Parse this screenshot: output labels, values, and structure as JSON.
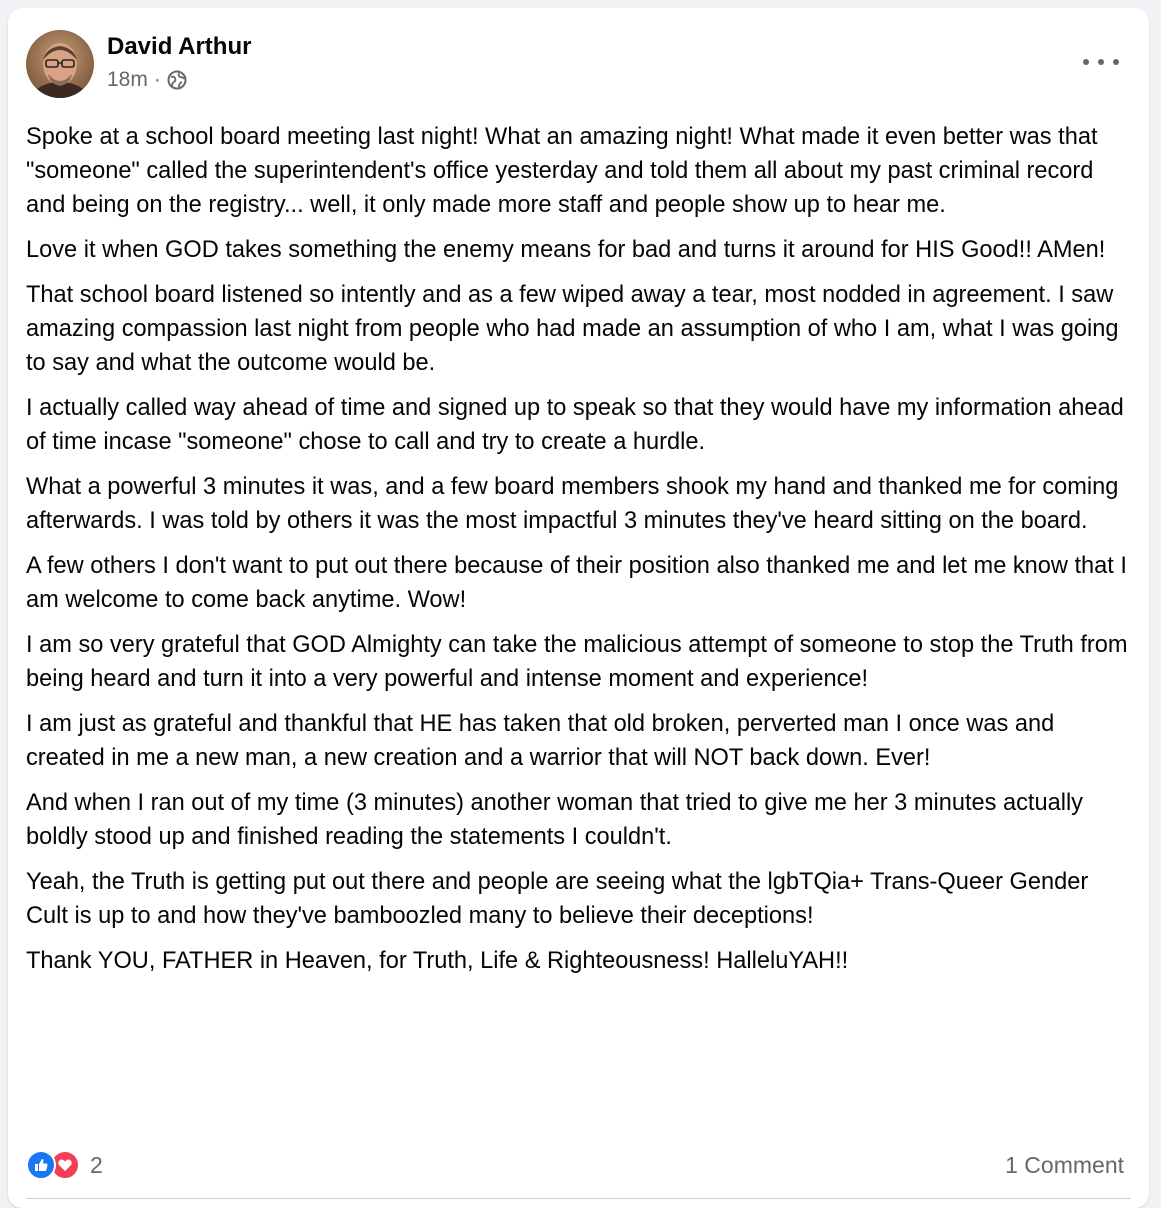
{
  "post": {
    "author": "David Arthur",
    "time": "18m",
    "separator": "·",
    "privacy_icon": "globe-icon",
    "more_icon": "more-options-icon",
    "paragraphs": [
      "Spoke at a school board meeting last night! What an amazing night! What made it even better was that \"someone\" called the superintendent's office yesterday and told them all about my past criminal record and being on the registry... well, it only made more staff and people show up to hear me.",
      "Love it when GOD takes something the enemy means for bad and turns it around for HIS Good!! AMen!",
      "That school board listened so intently and as a few wiped away a tear, most nodded in agreement. I saw amazing compassion last night from people who had made an assumption of who I am, what I was going to say and what the outcome would be.",
      "I actually called way ahead of time and signed up to speak so that they would have my information ahead of time incase \"someone\" chose to call and try to create a hurdle.",
      "What a powerful 3 minutes it was, and a few board members shook my hand and thanked me for coming afterwards. I was told by others it was the most impactful 3 minutes they've heard sitting on the board.",
      "A few others I don't want to put out there because of their position also thanked me and let me know that I am welcome to come back anytime. Wow!",
      "I am so very grateful that GOD Almighty can take the malicious attempt of someone to stop the Truth from being heard and turn it into a very powerful and intense moment and experience!",
      "I am just as grateful and thankful that HE has taken that old broken, perverted man I once was and created in me a new man, a new creation and a warrior that will NOT back down. Ever!",
      "And when I ran out of my time (3 minutes) another woman that tried to give me her 3 minutes actually boldly stood up and finished reading the statements I couldn't.",
      "Yeah, the Truth is getting put out there and people are seeing what the lgbTQia+ Trans-Queer Gender Cult is up to and how they've bamboozled many to believe their deceptions!",
      "Thank YOU, FATHER in Heaven, for Truth, Life & Righteousness! HalleluYAH!!"
    ],
    "reactions": {
      "icons": [
        "like-icon",
        "love-icon"
      ],
      "count": "2"
    },
    "comments_label": "1 Comment"
  },
  "colors": {
    "like": "#1877f2",
    "love": "#f33e58",
    "secondary_text": "#65676b",
    "primary_text": "#050505"
  }
}
